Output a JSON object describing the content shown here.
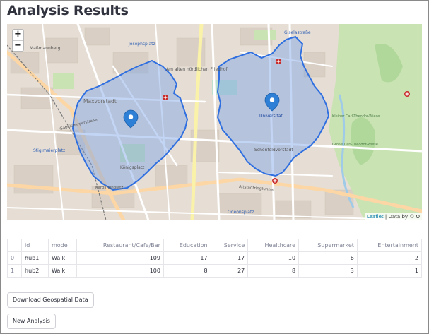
{
  "page": {
    "title": "Analysis Results"
  },
  "map": {
    "zoom_in": "+",
    "zoom_out": "−",
    "attribution_link": "Leaflet",
    "attribution_text": "| Data by © O",
    "labels": {
      "josephsplatz": "Josephsplatz",
      "giselastrasse": "Giselastraße",
      "massmannberg": "Maßmannberg",
      "alter_friedhof": "Am alten nördlichen Friedhof",
      "maxvorstadt": "Maxvorstadt",
      "universitaet": "Universität",
      "gabelsberger": "Gabelsbergerstraße",
      "schoenfeld": "Schönfeldvorstadt",
      "stiglmaierplatz": "Stiglmaierplatz",
      "koenigsplatz": "Königsplatz",
      "altstadtring": "Altstadtringtunnel",
      "odeonsplatz": "Odeonsplatz",
      "karolinenplatz": "Karolinenplatz",
      "kleiner_see": "Kleiner Carl-Theodor-Wiese",
      "grosse_wiese": "Große Carl-Theodor-Wiese"
    },
    "colors": {
      "isochrone_fill": "#7aa2e6",
      "isochrone_stroke": "#2f6fe0",
      "marker": "#2e7fd6"
    }
  },
  "table": {
    "columns": [
      "",
      "id",
      "mode",
      "Restaurant/Cafe/Bar",
      "Education",
      "Service",
      "Healthcare",
      "Supermarket",
      "Entertainment"
    ],
    "rows": [
      [
        "0",
        "hub1",
        "Walk",
        "109",
        "17",
        "17",
        "10",
        "6",
        "2"
      ],
      [
        "1",
        "hub2",
        "Walk",
        "100",
        "8",
        "27",
        "8",
        "3",
        "1"
      ]
    ]
  },
  "buttons": {
    "download": "Download Geospatial Data",
    "new_analysis": "New Analysis"
  }
}
